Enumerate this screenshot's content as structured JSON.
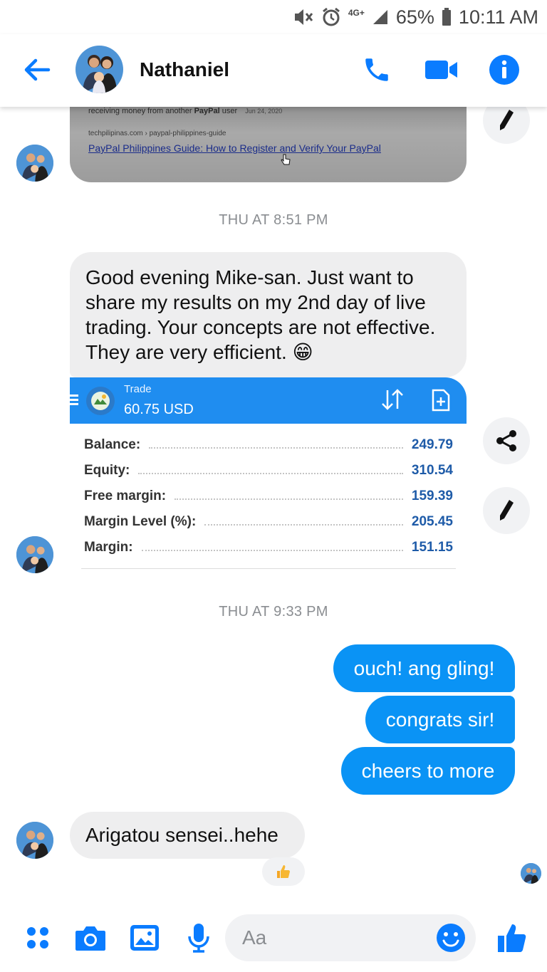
{
  "status_bar": {
    "network": "4G+",
    "battery": "65%",
    "time": "10:11 AM"
  },
  "header": {
    "contact_name": "Nathaniel"
  },
  "link_preview": {
    "line1_text": "receiving money from another",
    "line1_bold": "PayPal",
    "line1_end": "user",
    "date": "Jun 24, 2020",
    "url": "techpilipinas.com › paypal-philippines-guide",
    "title": "PayPal Philippines Guide: How to Register and Verify Your PayPal"
  },
  "messages": {
    "timestamp1": "THU AT 8:51 PM",
    "incoming1": "Good evening Mike-san. Just want to share my results on my 2nd day of live trading. Your concepts are not effective. They are very efficient. 😁",
    "timestamp2": "THU AT 9:33 PM",
    "outgoing1": "ouch! ang gling!",
    "outgoing2": "congrats sir!",
    "outgoing3": "cheers to more",
    "incoming2": "Arigatou sensei..hehe",
    "reaction": "👍"
  },
  "trade": {
    "label": "Trade",
    "amount": "60.75 USD",
    "rows": [
      {
        "label": "Balance:",
        "value": "249.79"
      },
      {
        "label": "Equity:",
        "value": "310.54"
      },
      {
        "label": "Free margin:",
        "value": "159.39"
      },
      {
        "label": "Margin Level (%):",
        "value": "205.45"
      },
      {
        "label": "Margin:",
        "value": "151.15"
      }
    ]
  },
  "composer": {
    "placeholder": "Aa"
  },
  "colors": {
    "accent": "#0a93f5",
    "incoming_bubble": "#eeeeef",
    "trade_header": "#1f8df0",
    "trade_value": "#1e5ba8"
  },
  "icons": [
    "mute-icon",
    "alarm-icon",
    "signal-icon",
    "battery-icon",
    "back-arrow-icon",
    "phone-icon",
    "video-icon",
    "info-icon",
    "pencil-icon",
    "share-icon",
    "apps-icon",
    "camera-icon",
    "gallery-icon",
    "microphone-icon",
    "emoji-icon",
    "thumbs-up-icon"
  ]
}
